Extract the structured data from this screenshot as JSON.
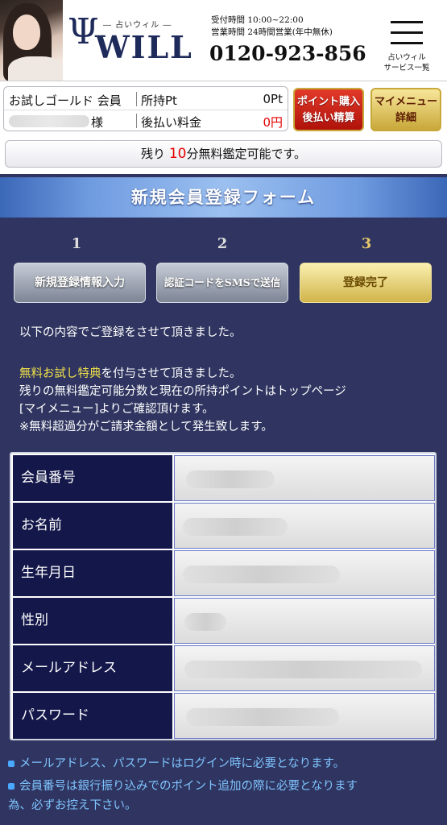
{
  "header": {
    "logo_sub": "― 占いウィル ―",
    "logo_text": "WILL",
    "hours_line1": "受付時間 10:00~22:00",
    "hours_line2": "営業時間 24時間営業(年中無休)",
    "phone": "0120-923-856",
    "menu_label_1": "占いウィル",
    "menu_label_2": "サービス一覧"
  },
  "account": {
    "rank": "お試しゴールド 会員",
    "points_label": "所持Pt",
    "points_value": "0Pt",
    "sama": "様",
    "deferred_label": "後払い料金",
    "deferred_value": "0円",
    "buy_button_line1": "ポイント購入",
    "buy_button_line2": "後払い精算",
    "mymenu_button_line1": "マイメニュー",
    "mymenu_button_line2": "詳細"
  },
  "remain": {
    "prefix": "残り",
    "minutes": "10",
    "suffix": "分無料鑑定可能です。"
  },
  "form": {
    "title": "新規会員登録フォーム",
    "steps": [
      {
        "num": "1",
        "label": "新規登録情報入力"
      },
      {
        "num": "2",
        "label": "認証コードをSMSで送信"
      },
      {
        "num": "3",
        "label": "登録完了"
      }
    ]
  },
  "messages": {
    "line1": "以下の内容でご登録をさせて頂きました。",
    "line2_highlight": "無料お試し特典",
    "line2_rest": "を付与させて頂きました。",
    "line3": "残りの無料鑑定可能分数と現在の所持ポイントはトップページ",
    "line4": "[マイメニュー]よりご確認頂けます。",
    "line5": "※無料超過分がご請求金額として発生致します。"
  },
  "table": {
    "rows": [
      {
        "label": "会員番号"
      },
      {
        "label": "お名前"
      },
      {
        "label": "生年月日"
      },
      {
        "label": "性別"
      },
      {
        "label": "メールアドレス"
      },
      {
        "label": "パスワード"
      }
    ]
  },
  "notes": {
    "note1": "メールアドレス、パスワードはログイン時に必要となります。",
    "note2_line1": "会員番号は銀行振り込みでのポイント追加の際に必要となります",
    "note2_line2": "為、必ずお控え下さい。"
  }
}
